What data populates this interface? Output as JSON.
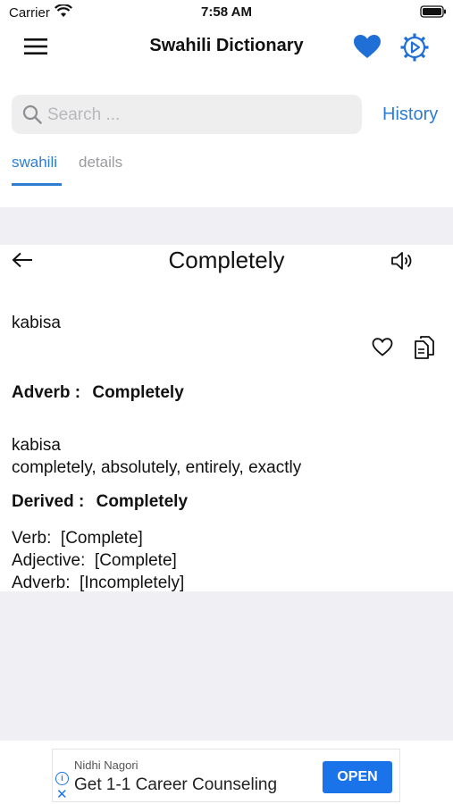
{
  "status_bar": {
    "carrier": "Carrier",
    "time": "7:58 AM"
  },
  "header": {
    "title": "Swahili Dictionary",
    "menu_icon": "hamburger-menu-icon",
    "favorite_icon": "heart-icon",
    "settings_icon": "gear-icon"
  },
  "search": {
    "placeholder": "Search ...",
    "history_label": "History"
  },
  "tabs": [
    {
      "label": "swahili",
      "active": true
    },
    {
      "label": "details",
      "active": false
    }
  ],
  "entry": {
    "word": "Completely",
    "translation": "kabisa",
    "sections": [
      {
        "heading_label": "Adverb :",
        "heading_value": "Completely",
        "lines": [
          "kabisa",
          "completely, absolutely, entirely, exactly"
        ]
      },
      {
        "heading_label": "Derived :",
        "heading_value": "Completely",
        "lines": [
          "Verb:  [Complete]",
          "Adjective:  [Complete]",
          "Adverb:  [Incompletely]"
        ]
      }
    ]
  },
  "ad": {
    "advertiser": "Nidhi Nagori",
    "headline": "Get 1-1 Career Counseling",
    "cta": "OPEN"
  },
  "colors": {
    "accent": "#2d7dd2",
    "band": "#efeff4",
    "ad_button": "#1a73e8"
  }
}
